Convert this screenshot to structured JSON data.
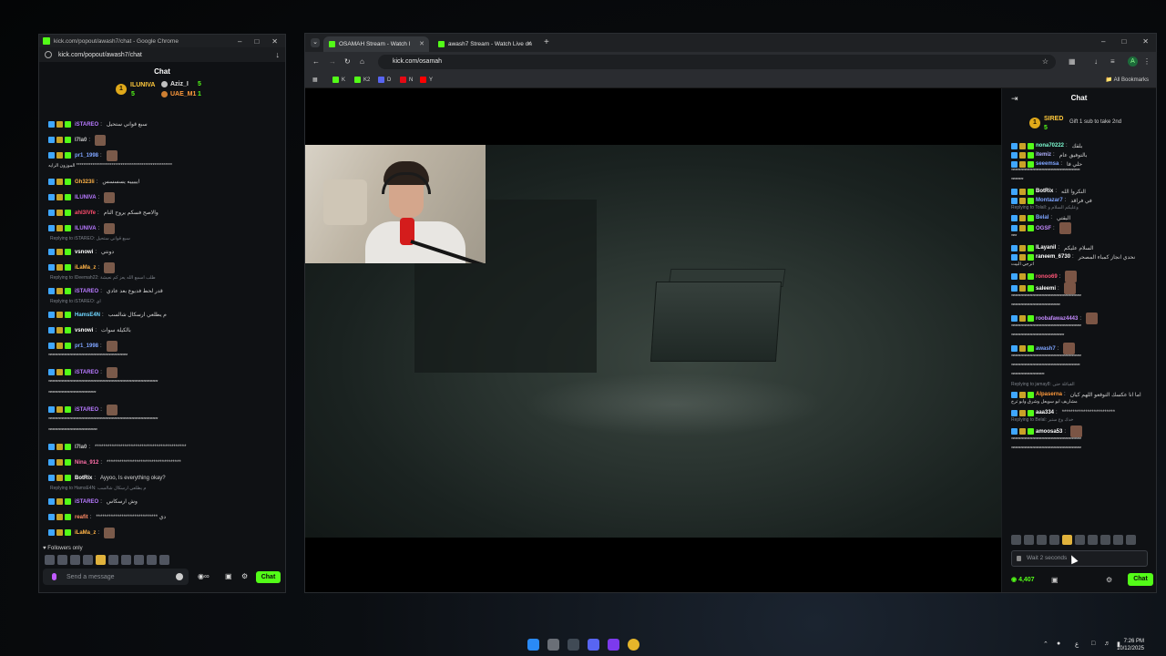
{
  "popout": {
    "title": "kick.com/popout/awash7/chat - Google Chrome",
    "url": "kick.com/popout/awash7/chat",
    "header": "Chat",
    "pinned": [
      {
        "rank": "1",
        "name": "ILUNIVA",
        "count": "5"
      },
      {
        "name": "Aziz_I",
        "count": "5"
      },
      {
        "name": "UAE_M1",
        "count": "1"
      }
    ],
    "followers_only": "Followers only",
    "input_placeholder": "Send a message",
    "chat_button": "Chat"
  },
  "popout_messages": [
    {
      "name": "iSTAREO",
      "color": "#b779ff",
      "text": "سبع قواني ستحيل"
    },
    {
      "name": "l7la0",
      "color": "#c7c7c7",
      "text": ""
    },
    {
      "name": "pr1_1998",
      "color": "#7ea4ff",
      "text": ""
    },
    {
      "cont": "الموزون الرايه ******************************************************"
    },
    {
      "name": "Gh323li",
      "color": "#ffb347",
      "text": "ايييييه يسسسس"
    },
    {
      "name": "ILUNIVA",
      "color": "#b779ff",
      "text": ""
    },
    {
      "name": "ahl3lVfe",
      "color": "#ff4d6d",
      "text": "والاصح فسكم يروح النام"
    },
    {
      "name": "ILUNIVA",
      "color": "#b779ff",
      "text": ""
    },
    {
      "reply": "Replying to iSTAREO: سبع قواني ستحيل"
    },
    {
      "name": "vsnowi",
      "color": "#ffffff",
      "text": "دونتي"
    },
    {
      "name": "iLaMa_z",
      "color": "#ffb347",
      "text": ""
    },
    {
      "reply": "Replying to IDeemah22: طلب اسمع الله يعز كم نعيشة"
    },
    {
      "name": "iSTAREO",
      "color": "#b779ff",
      "text": "قدر لحط فديوع بعد عادي"
    },
    {
      "reply": "Replying to iSTAREO: اي"
    },
    {
      "name": "HamsE4N",
      "color": "#6fd6ff",
      "text": "م يطلعي ارسكال شالسب"
    },
    {
      "name": "vsnowi",
      "color": "#ffffff",
      "text": "بالكيلة سوات"
    },
    {
      "name": "pr1_1998",
      "color": "#7ea4ff",
      "text": ""
    },
    {
      "cont": "************************************************************"
    },
    {
      "name": "iSTAREO",
      "color": "#b779ff",
      "text": ""
    },
    {
      "cont": "***********************************************************************************"
    },
    {
      "cont": "************************************"
    },
    {
      "name": "iSTAREO",
      "color": "#b779ff",
      "text": ""
    },
    {
      "cont": "***********************************************************************************"
    },
    {
      "cont": "*************************************"
    },
    {
      "name": "l7la0",
      "color": "#c7c7c7",
      "text": "*******************************************"
    },
    {
      "name": "Nina_912",
      "color": "#ff6fa8",
      "text": "***********************************"
    },
    {
      "name": "BotRix",
      "color": "#ffffff",
      "text": "Ayyoo, Is everything okay?"
    },
    {
      "reply": "Replying to HamsE4N: م يطلعي ارسكال شالسب"
    },
    {
      "name": "iSTAREO",
      "color": "#b779ff",
      "text": "وش ارسكاس"
    },
    {
      "name": "reafit",
      "color": "#ff8a65",
      "text": "***************************** دي"
    },
    {
      "name": "iLaMa_z",
      "color": "#ffb347",
      "text": ""
    },
    {
      "name": "pr1_1998",
      "color": "#7ea4ff",
      "text": ""
    }
  ],
  "browser": {
    "tabs": [
      {
        "title": "OSAMAH Stream - Watch l"
      },
      {
        "title": "awash7 Stream - Watch Live on"
      }
    ],
    "url": "kick.com/osamah",
    "bookmarks": [
      "K",
      "K2",
      "D",
      "N",
      "Y"
    ],
    "all_bookmarks": "All Bookmarks",
    "profile_letter": "A"
  },
  "sidechat": {
    "header": "Chat",
    "pinned_name": "SIRED",
    "pinned_rank": "1",
    "pinned_count": "5",
    "pinned_text": "Gift 1 sub to take 2nd",
    "input_placeholder": "Wait 2 seconds",
    "points": "4,407",
    "chat_button": "Chat"
  },
  "sidechat_messages": [
    {
      "name": "nona70222",
      "color": "#7fffd4",
      "text": "بلقك"
    },
    {
      "name": "itemiz",
      "color": "#b0b0ff",
      "text": "بالتوفيق عام"
    },
    {
      "name": "seeemsa",
      "color": "#7ea4ff",
      "text": "حلي فا"
    },
    {
      "cont": "****************************************************"
    },
    {
      "cont": "*********"
    },
    {
      "name": "BotRix",
      "color": "#ffffff",
      "text": "النكروا الله"
    },
    {
      "name": "Montazar7",
      "color": "#7ea4ff",
      "text": "في فراقد"
    },
    {
      "reply": "Replying to Tolall: وعليكم السلام و"
    },
    {
      "name": "Belal",
      "color": "#7ea4ff",
      "text": "البقتي"
    },
    {
      "name": "OGSF",
      "color": "#c58bff",
      "text": ""
    },
    {
      "cont": "****"
    },
    {
      "name": "ILayanil",
      "color": "#ffffff",
      "text": "السلام عليكم"
    },
    {
      "name": "raneem_6730",
      "color": "#ffffff",
      "text": "نحدي انجاز كمباء المصحر"
    },
    {
      "cont": "انرجي البيت"
    },
    {
      "name": "ronoo69",
      "color": "#ff5577",
      "text": ""
    },
    {
      "name": "saleemi",
      "color": "#ffffff",
      "text": ""
    },
    {
      "cont": "*****************************************************"
    },
    {
      "cont": "*************************************"
    },
    {
      "name": "roobafawaz4443",
      "color": "#c58bff",
      "text": ""
    },
    {
      "cont": "*****************************************************"
    },
    {
      "cont": "****************************************"
    },
    {
      "name": "awash7",
      "color": "#7ea4ff",
      "text": ""
    },
    {
      "cont": "*****************************************************"
    },
    {
      "cont": "****************************************************"
    },
    {
      "cont": "*************************"
    },
    {
      "reply": "Replying to jamay8: القبائلة حتى"
    },
    {
      "name": "Alpaserna",
      "color": "#ff9a3c",
      "text": "اما انا عكسك التوقعو اللهم كيان"
    },
    {
      "cont": "مشاريف ابو سويعل وشرق وابو ترح"
    },
    {
      "name": "aaa334",
      "color": "#ffffff",
      "text": "*************************"
    },
    {
      "reply": "Replying to Belal: خدك وع ستبر"
    },
    {
      "name": "amoosa53",
      "color": "#ffffff",
      "text": ""
    },
    {
      "cont": "*****************************************************"
    },
    {
      "cont": "*****************************************************"
    }
  ],
  "taskbar": {
    "time": "7:26 PM",
    "date": "10/12/2025"
  }
}
